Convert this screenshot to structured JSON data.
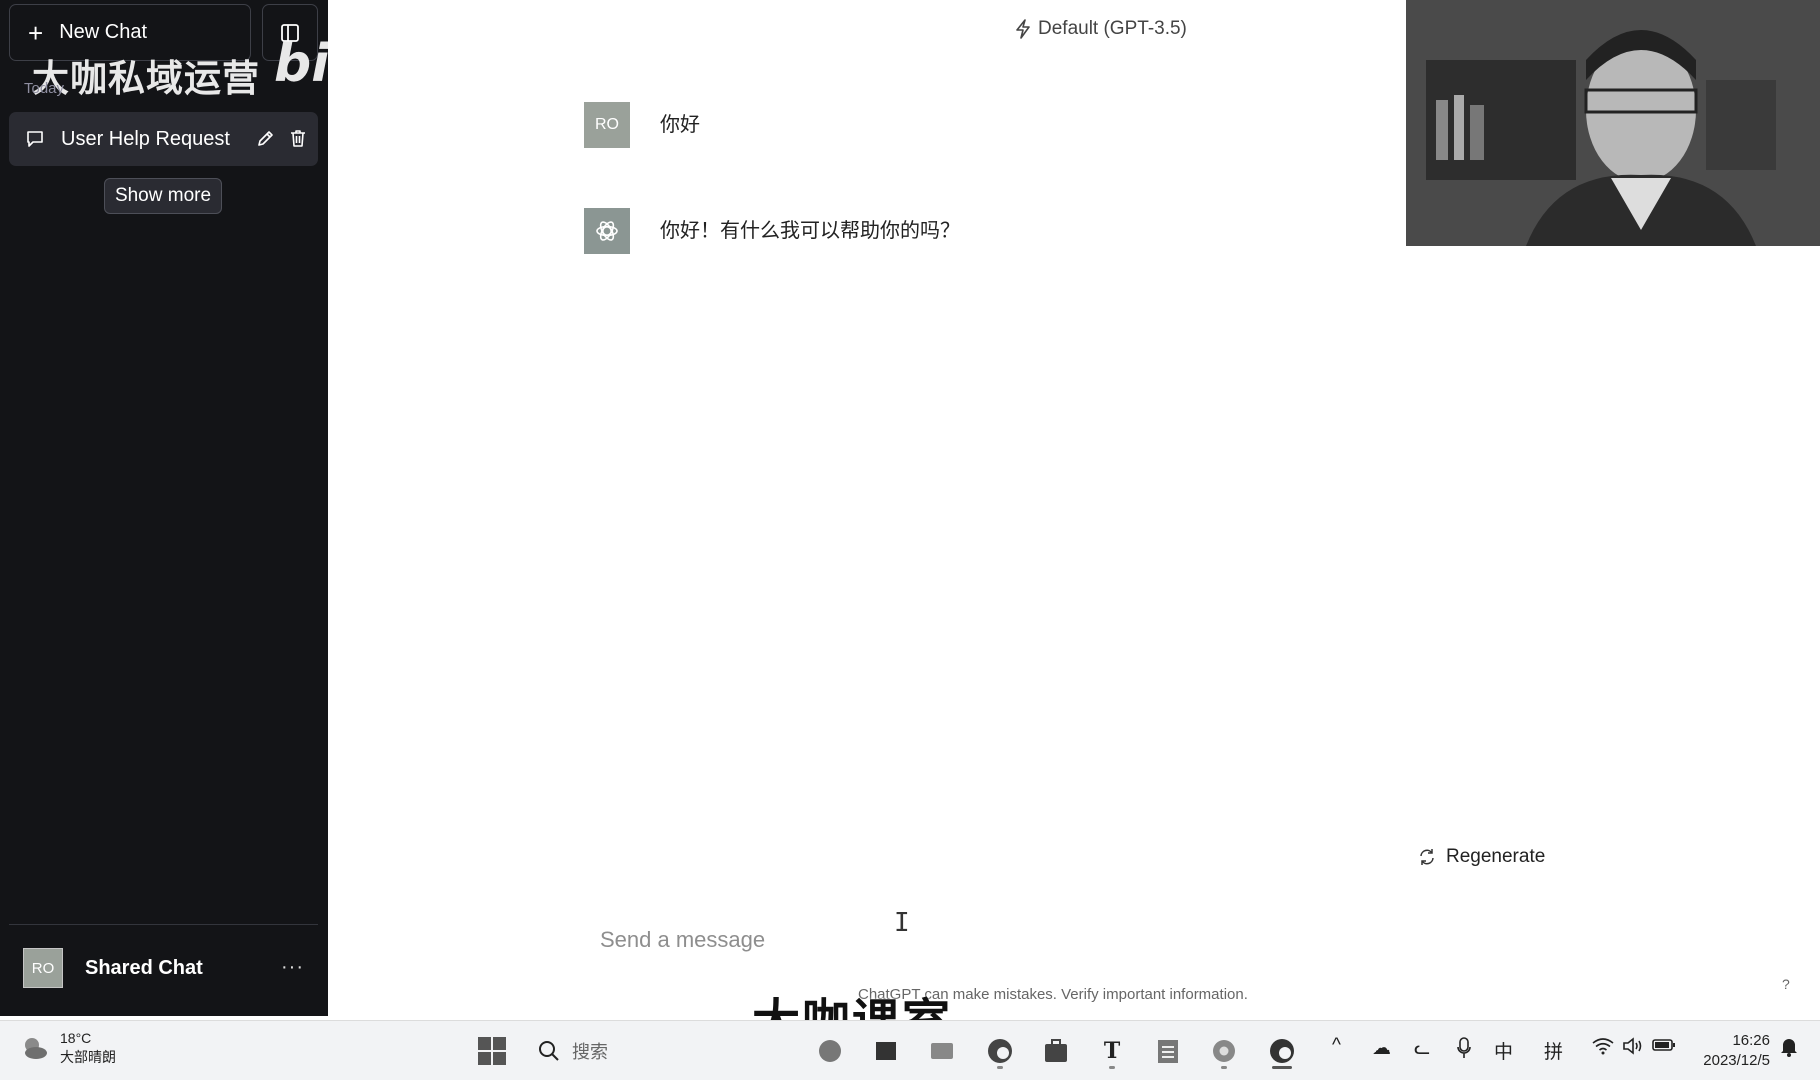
{
  "sidebar": {
    "new_chat_label": "New Chat",
    "group_label": "Today",
    "chats": [
      {
        "title": "User Help Request"
      }
    ],
    "show_more_label": "Show more",
    "profile": {
      "initials": "RO",
      "name": "Shared Chat",
      "more": "···"
    }
  },
  "watermarks": {
    "top": "大咖私域运营",
    "bili": "bili",
    "bottom": "大咖课室"
  },
  "main": {
    "model_label": "Default (GPT-3.5)",
    "messages": [
      {
        "role": "user",
        "avatar": "RO",
        "text": "你好"
      },
      {
        "role": "assistant",
        "text": "你好！有什么我可以帮助你的吗？"
      }
    ],
    "regenerate_label": "Regenerate",
    "input_placeholder": "Send a message",
    "disclaimer": "ChatGPT can make mistakes. Verify important information.",
    "help": "?"
  },
  "taskbar": {
    "weather_temp": "18°C",
    "weather_desc": "大部晴朗",
    "search_label": "搜索",
    "tray": {
      "ime_lang": "中",
      "ime_mode": "拼"
    },
    "time": "16:26",
    "date": "2023/12/5"
  },
  "colors": {
    "sidebar_bg": "#131417",
    "sidebar_item_bg": "#2a2b32",
    "taskbar_bg": "#f2f3f5"
  }
}
